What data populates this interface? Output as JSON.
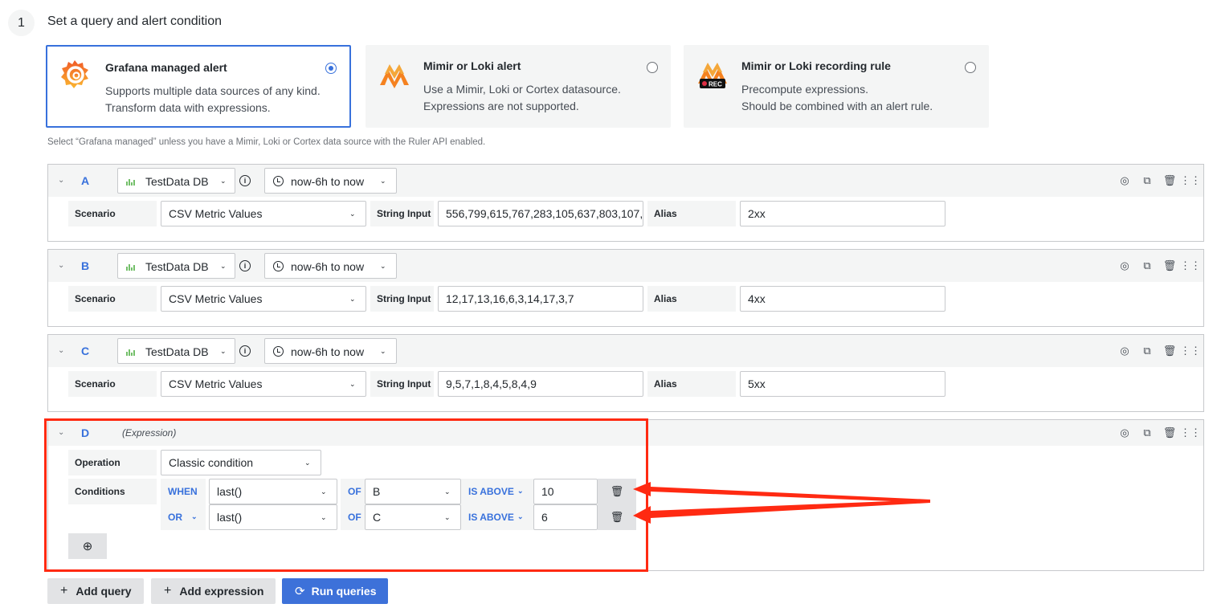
{
  "step": {
    "number": "1",
    "title": "Set a query and alert condition"
  },
  "alert_types": [
    {
      "title": "Grafana managed alert",
      "desc1": "Supports multiple data sources of any kind.",
      "desc2": "Transform data with expressions.",
      "selected": true,
      "icon": "grafana-logo-icon"
    },
    {
      "title": "Mimir or Loki alert",
      "desc1": "Use a Mimir, Loki or Cortex datasource.",
      "desc2": "Expressions are not supported.",
      "selected": false,
      "icon": "mimir-logo-icon"
    },
    {
      "title": "Mimir or Loki recording rule",
      "desc1": "Precompute expressions.",
      "desc2": "Should be combined with an alert rule.",
      "selected": false,
      "icon": "mimir-rec-logo-icon",
      "badge": "REC"
    }
  ],
  "hint": "Select “Grafana managed” unless you have a Mimir, Loki or Cortex data source with the Ruler API enabled.",
  "queries": [
    {
      "letter": "A",
      "datasource": "TestData DB",
      "time_range": "now-6h to now",
      "scenario_label": "Scenario",
      "scenario": "CSV Metric Values",
      "string_input_label": "String Input",
      "string_input": "556,799,615,767,283,105,637,803,107,",
      "alias_label": "Alias",
      "alias": "2xx"
    },
    {
      "letter": "B",
      "datasource": "TestData DB",
      "time_range": "now-6h to now",
      "scenario_label": "Scenario",
      "scenario": "CSV Metric Values",
      "string_input_label": "String Input",
      "string_input": "12,17,13,16,6,3,14,17,3,7",
      "alias_label": "Alias",
      "alias": "4xx"
    },
    {
      "letter": "C",
      "datasource": "TestData DB",
      "time_range": "now-6h to now",
      "scenario_label": "Scenario",
      "scenario": "CSV Metric Values",
      "string_input_label": "String Input",
      "string_input": "9,5,7,1,8,4,5,8,4,9",
      "alias_label": "Alias",
      "alias": "5xx"
    }
  ],
  "expression": {
    "letter": "D",
    "type_label": "(Expression)",
    "operation_label": "Operation",
    "operation": "Classic condition",
    "conditions_label": "Conditions",
    "conditions": [
      {
        "joiner": "WHEN",
        "reducer": "last()",
        "of": "OF",
        "query": "B",
        "evaluator": "IS ABOVE",
        "value": "10"
      },
      {
        "joiner": "OR",
        "reducer": "last()",
        "of": "OF",
        "query": "C",
        "evaluator": "IS ABOVE",
        "value": "6"
      }
    ]
  },
  "buttons": {
    "add_query": "Add query",
    "add_expression": "Add expression",
    "run_queries": "Run queries"
  },
  "colors": {
    "accent": "#3871dc",
    "annotation": "#ff2a12"
  }
}
